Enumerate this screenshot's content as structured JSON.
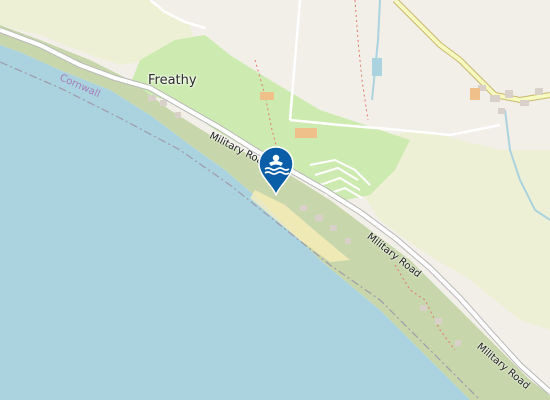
{
  "map": {
    "place_label": "Freathy",
    "road_labels": [
      "Military Road",
      "Military Road",
      "Military Road"
    ],
    "boundary_label": "Cornwall",
    "marker": {
      "icon": "swimming-icon",
      "color": "#0a5ea8"
    },
    "colors": {
      "sea": "#aad3df",
      "land": "#f2efe9",
      "grass": "#cdebb0",
      "farmland": "#eef0d5",
      "scrub": "#c8d7ab",
      "beach": "#fff1ba",
      "road": "#ffffff",
      "secondary_road": "#f7fabf",
      "stream": "#aad3df",
      "boundary": "#9e9cab"
    }
  }
}
